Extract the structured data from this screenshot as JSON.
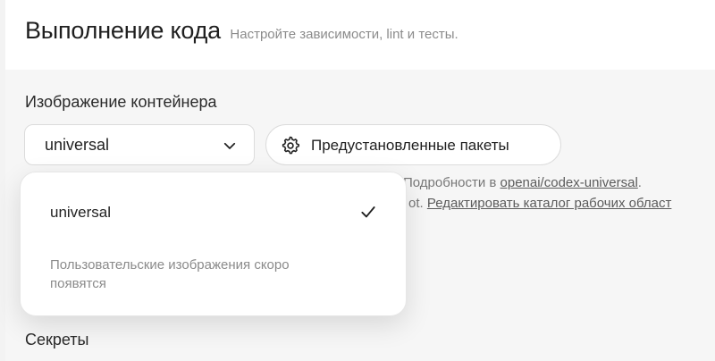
{
  "header": {
    "title": "Выполнение кода",
    "subtitle": "Настройте зависимости, lint и тесты."
  },
  "container_image": {
    "label": "Изображение контейнера",
    "selected_value": "universal",
    "preinstalled_packages_label": "Предустановленные пакеты"
  },
  "help": {
    "line1_prefix": "Подробности в ",
    "line1_link": "openai/codex-universal",
    "line1_suffix": ".",
    "line2_prefix": "ot. ",
    "line2_link": "Редактировать каталог рабочих област"
  },
  "dropdown": {
    "options": [
      {
        "label": "universal",
        "selected": true
      }
    ],
    "note": "Пользовательские изображения скоро появятся"
  },
  "sections": {
    "secrets_label": "Секреты"
  },
  "icons": {
    "select_chevron": "chevron-down-icon",
    "packages": "gear-icon",
    "selected_option": "check-icon"
  }
}
